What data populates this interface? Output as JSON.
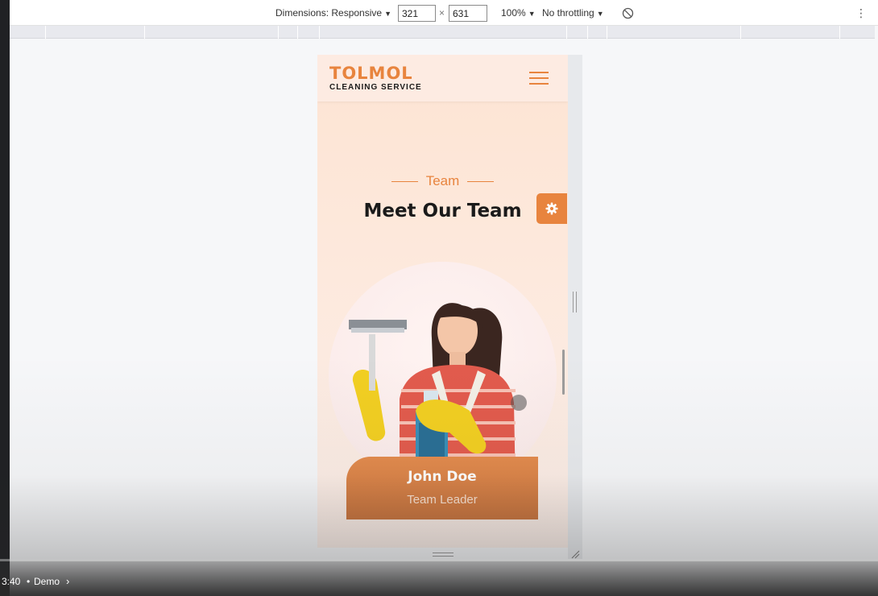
{
  "devtools": {
    "dimensions_label": "Dimensions: Responsive",
    "width_value": "321",
    "times_sign": "×",
    "height_value": "631",
    "zoom_label": "100%",
    "throttling_label": "No throttling",
    "dropdown_caret": "▼"
  },
  "site": {
    "logo_title": "TOLMOL",
    "logo_subtitle": "CLEANING SERVICE",
    "section_kicker": "Team",
    "section_title": "Meet Our Team",
    "member": {
      "name": "John Doe",
      "role": "Team Leader"
    }
  },
  "video": {
    "timestamp": "3:40",
    "separator": "•",
    "chapter": "Demo"
  },
  "colors": {
    "accent": "#e8843e",
    "page_bg": "#fde9dd",
    "title": "#1a1a1a"
  },
  "icons": [
    "hamburger-menu-icon",
    "gear-icon",
    "rotate-disabled-icon",
    "kebab-menu-icon",
    "chevron-right-icon"
  ]
}
